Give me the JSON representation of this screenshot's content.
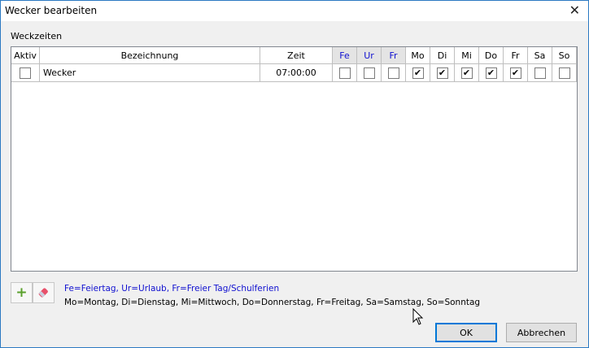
{
  "window": {
    "title": "Wecker bearbeiten"
  },
  "group_label": "Weckzeiten",
  "columns": [
    {
      "label": "Aktiv",
      "special": false
    },
    {
      "label": "Bezeichnung",
      "special": false
    },
    {
      "label": "Zeit",
      "special": false
    },
    {
      "label": "Fe",
      "special": true
    },
    {
      "label": "Ur",
      "special": true
    },
    {
      "label": "Fr",
      "special": true
    },
    {
      "label": "Mo",
      "special": false
    },
    {
      "label": "Di",
      "special": false
    },
    {
      "label": "Mi",
      "special": false
    },
    {
      "label": "Do",
      "special": false
    },
    {
      "label": "Fr",
      "special": false
    },
    {
      "label": "Sa",
      "special": false
    },
    {
      "label": "So",
      "special": false
    }
  ],
  "rows": [
    {
      "aktiv": false,
      "name": "Wecker",
      "time": "07:00:00",
      "days": [
        false,
        false,
        false,
        true,
        true,
        true,
        true,
        true,
        false,
        false
      ]
    }
  ],
  "legend": {
    "line1": "Fe=Feiertag, Ur=Urlaub, Fr=Freier Tag/Schulferien",
    "line2": "Mo=Montag, Di=Dienstag, Mi=Mittwoch, Do=Donnerstag, Fr=Freitag, Sa=Samstag, So=Sonntag"
  },
  "buttons": {
    "ok": "OK",
    "cancel": "Abbrechen"
  },
  "colors": {
    "special_header": "#1010d0",
    "add": "#5aa02c",
    "eraser": "#e04050"
  }
}
